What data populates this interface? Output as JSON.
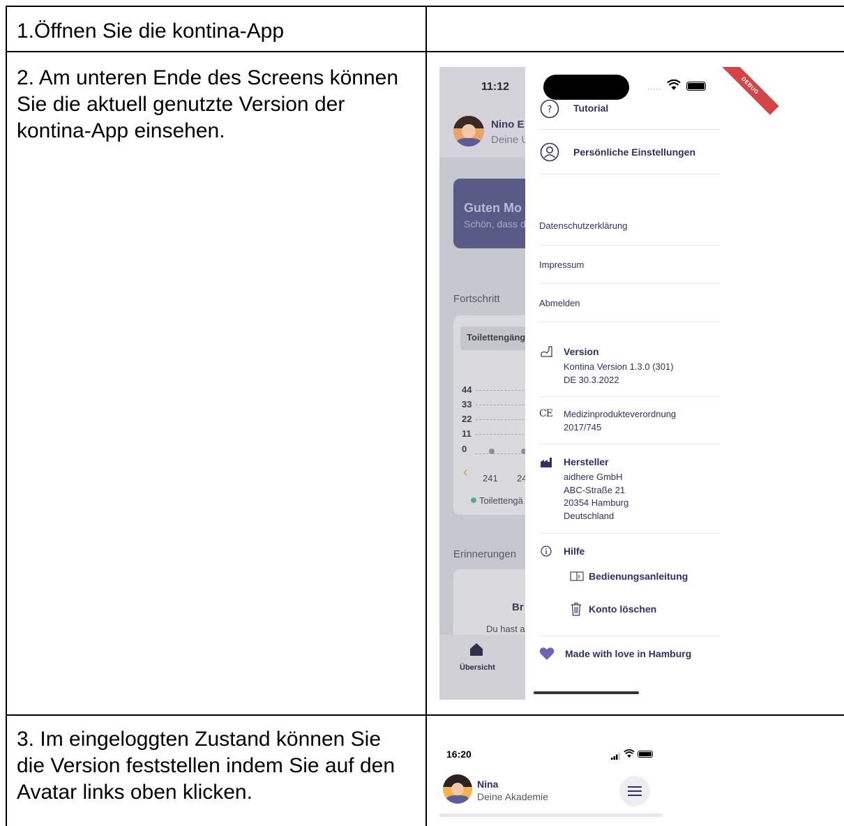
{
  "steps": [
    {
      "text": "1.Öffnen Sie die kontina-App"
    },
    {
      "text": "2. Am unteren Ende des Screens können Sie die aktuell genutzte Version der kontina-App einsehen."
    },
    {
      "text": "3. Im eingeloggten Zustand können Sie die Version feststellen indem Sie auf den Avatar links oben klicken."
    }
  ],
  "shot1": {
    "status_time": "11:12",
    "debug_label": "DEBUG",
    "background": {
      "user_name": "Nino E",
      "user_sub": "Deine U",
      "greeting_title": "Guten Mo",
      "greeting_sub": "Schön, dass d",
      "progress_label": "Fortschritt",
      "progress_tag": "Toilettengäng",
      "chart_ticks": [
        "44",
        "33",
        "22",
        "11",
        "0"
      ],
      "chart_x": [
        "241",
        "24"
      ],
      "legend": "Toilettengä",
      "reminders_label": "Erinnerungen",
      "reminder_title": "Br",
      "reminder_sub": "Du hast a",
      "nav_home": "Übersicht"
    },
    "menu": {
      "tutorial": "Tutorial",
      "personal_settings": "Persönliche Einstellungen",
      "privacy": "Datenschutzerklärung",
      "imprint": "Impressum",
      "logout": "Abmelden",
      "version_title": "Version",
      "version_line1": "Kontina Version 1.3.0 (301)",
      "version_line2": "DE 30.3.2022",
      "ce_mark": "CE",
      "regulation_line1": "Medizinprodukteverordnung",
      "regulation_line2": "2017/745",
      "manufacturer_title": "Hersteller",
      "manufacturer_lines": [
        "aidhere GmbH",
        "ABC-Straße 21",
        "20354 Hamburg",
        "Deutschland"
      ],
      "help_title": "Hilfe",
      "manual": "Bedienungsanleitung",
      "delete_account": "Konto löschen",
      "made_with_love": "Made with love in Hamburg"
    }
  },
  "shot2": {
    "status_time": "16:20",
    "user_name": "Nina",
    "user_sub": "Deine Akademie"
  },
  "colors": {
    "menu_text": "#2e2f6b",
    "heart": "#6f63b8",
    "debug_ribbon": "#d64545"
  }
}
